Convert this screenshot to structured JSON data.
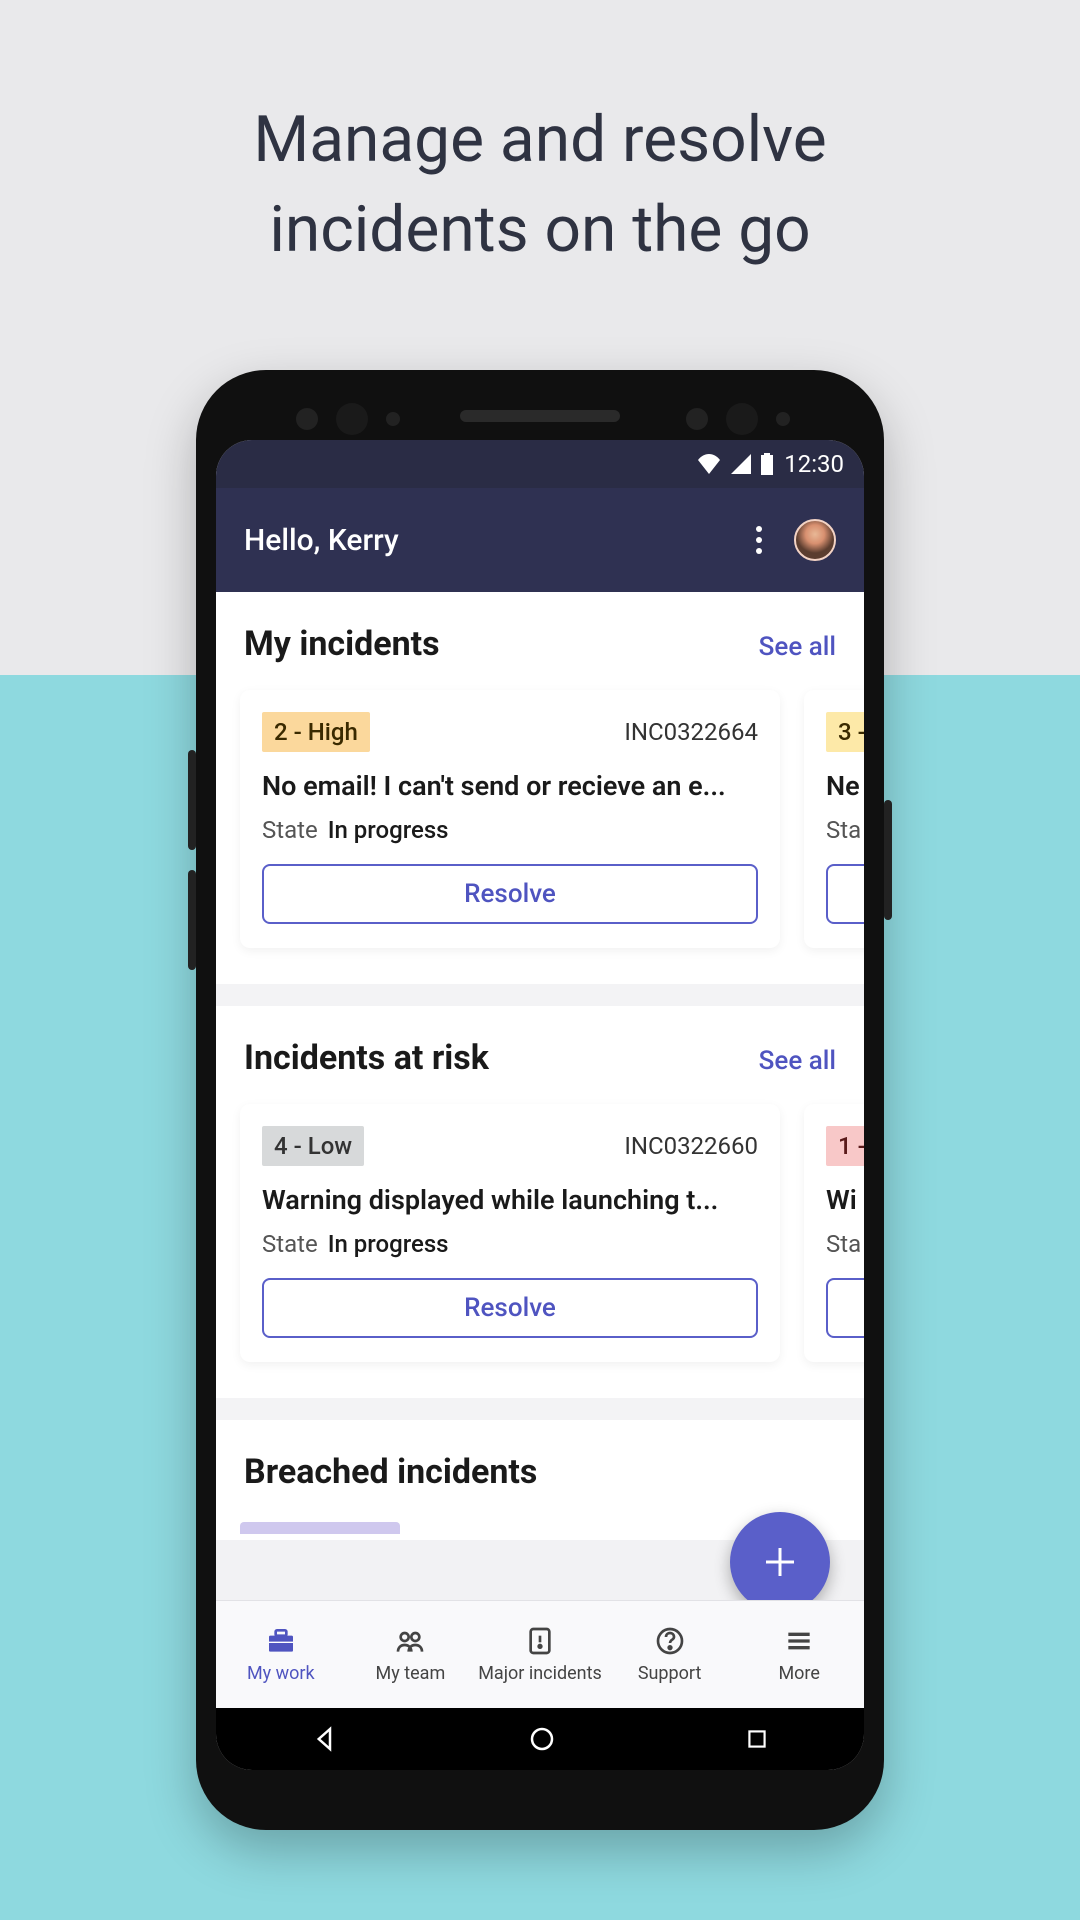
{
  "marketing": {
    "headline_line1": "Manage and resolve",
    "headline_line2": "incidents on the go"
  },
  "status": {
    "time": "12:30"
  },
  "header": {
    "greeting": "Hello, Kerry"
  },
  "sections": {
    "my_incidents": {
      "title": "My incidents",
      "see_all": "See all"
    },
    "at_risk": {
      "title": "Incidents at risk",
      "see_all": "See all"
    },
    "breached": {
      "title": "Breached incidents"
    }
  },
  "labels": {
    "state": "State",
    "resolve": "Resolve"
  },
  "cards": {
    "mi0": {
      "priority": "2 - High",
      "ticket": "INC0322664",
      "title": "No email! I can't send or recieve an e...",
      "state": "In progress"
    },
    "mi1": {
      "priority": "3 -",
      "title": "Ne",
      "state_prefix": "Sta"
    },
    "ar0": {
      "priority": "4 - Low",
      "ticket": "INC0322660",
      "title": "Warning displayed while launching t...",
      "state": "In progress"
    },
    "ar1": {
      "priority": "1 -",
      "title": "Wi",
      "state_prefix": "Sta"
    }
  },
  "tabs": {
    "my_work": "My work",
    "my_team": "My team",
    "major": "Major incidents",
    "support": "Support",
    "more": "More"
  }
}
